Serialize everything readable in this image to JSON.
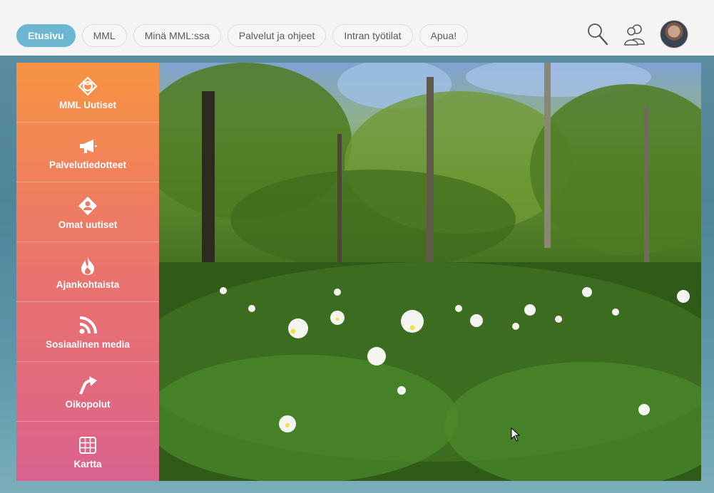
{
  "nav": {
    "tabs": [
      {
        "label": "Etusivu",
        "active": true
      },
      {
        "label": "MML"
      },
      {
        "label": "Minä MML:ssa"
      },
      {
        "label": "Palvelut ja ohjeet"
      },
      {
        "label": "Intran työtilat"
      },
      {
        "label": "Apua!"
      }
    ]
  },
  "toolbar": {
    "search_icon": "search-icon",
    "people_icon": "people-icon",
    "avatar": "user-avatar"
  },
  "sidebar": {
    "items": [
      {
        "label": "MML Uutiset",
        "icon": "mml-logo-icon"
      },
      {
        "label": "Palvelutiedotteet",
        "icon": "megaphone-icon"
      },
      {
        "label": "Omat uutiset",
        "icon": "person-tag-icon"
      },
      {
        "label": "Ajankohtaista",
        "icon": "flame-icon"
      },
      {
        "label": "Sosiaalinen media",
        "icon": "rss-icon"
      },
      {
        "label": "Oikopolut",
        "icon": "arrow-icon"
      },
      {
        "label": "Kartta",
        "icon": "grid-map-icon"
      }
    ]
  },
  "colors": {
    "active_tab": "#6db6d2",
    "sidebar_top": "#f79441",
    "sidebar_bottom": "#d9628f"
  }
}
